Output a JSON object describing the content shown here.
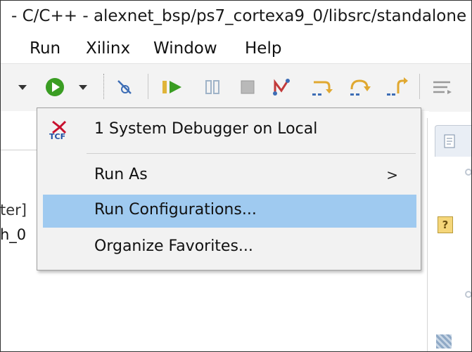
{
  "window": {
    "title": "- C/C++ - alexnet_bsp/ps7_cortexa9_0/libsrc/standalone"
  },
  "menubar": {
    "items": [
      "Run",
      "Xilinx",
      "Window",
      "Help"
    ]
  },
  "toolbar": {
    "icons": [
      "dropdown-arrow-icon",
      "run-icon",
      "run-dropdown-arrow-icon",
      "skip-breakpoints-icon",
      "resume-icon",
      "suspend-icon",
      "terminate-icon",
      "disconnect-icon",
      "step-into-icon",
      "step-over-icon",
      "step-return-icon",
      "word-wrap-icon"
    ]
  },
  "left_panel": {
    "text_fragments": [
      "ter]",
      "h_0"
    ]
  },
  "run_menu": {
    "items": [
      {
        "label": "1 System Debugger on Local",
        "icon": "tcf-icon",
        "icon_text": "TCF"
      },
      {
        "label": "Run As",
        "submenu": true
      },
      {
        "label": "Run Configurations...",
        "highlighted": true
      },
      {
        "label": "Organize Favorites..."
      }
    ],
    "submenu_indicator": ">"
  },
  "colors": {
    "highlight": "#9fcaf0",
    "run_green": "#3a9d23",
    "menu_bg": "#f2f2f2",
    "xilinx_red": "#c8102e",
    "tcf_blue": "#1f4fa3"
  }
}
